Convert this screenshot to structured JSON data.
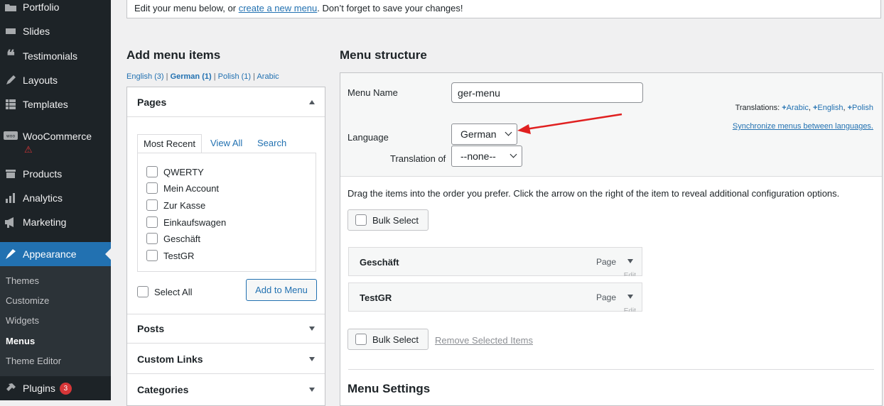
{
  "sidebar": {
    "items": [
      {
        "label": "Portfolio",
        "icon": "portfolio-icon"
      },
      {
        "label": "Slides",
        "icon": "slides-icon"
      },
      {
        "label": "Testimonials",
        "icon": "quote-icon"
      },
      {
        "label": "Layouts",
        "icon": "layouts-icon"
      },
      {
        "label": "Templates",
        "icon": "templates-icon"
      },
      {
        "label": "WooCommerce",
        "icon": "woocommerce-icon"
      },
      {
        "label": "Products",
        "icon": "products-icon"
      },
      {
        "label": "Analytics",
        "icon": "analytics-icon"
      },
      {
        "label": "Marketing",
        "icon": "marketing-icon"
      },
      {
        "label": "Appearance",
        "icon": "appearance-icon"
      },
      {
        "label": "Plugins",
        "icon": "plugins-icon",
        "badge": "3"
      }
    ],
    "submenu": [
      "Themes",
      "Customize",
      "Widgets",
      "Menus",
      "Theme Editor"
    ],
    "woo_warning": "⚠"
  },
  "notice": {
    "before": "Edit your menu below, or ",
    "link": "create a new menu",
    "after": ". Don’t forget to save your changes!"
  },
  "add_items": {
    "title": "Add menu items",
    "langs": {
      "english": "English (3)",
      "german": "German (1)",
      "polish": "Polish (1)",
      "arabic": "Arabic",
      "sep": "|"
    },
    "pages_title": "Pages",
    "tabs": [
      "Most Recent",
      "View All",
      "Search"
    ],
    "pages": [
      "QWERTY",
      "Mein Account",
      "Zur Kasse",
      "Einkaufswagen",
      "Geschäft",
      "TestGR"
    ],
    "select_all": "Select All",
    "add_button": "Add to Menu",
    "sections": [
      "Posts",
      "Custom Links",
      "Categories"
    ]
  },
  "structure": {
    "title": "Menu structure",
    "menu_name_label": "Menu Name",
    "menu_name_value": "ger-menu",
    "language_label": "Language",
    "language_value": "German",
    "translation_label": "Translation of",
    "translation_value": "--none--",
    "translations_label": "Translations:",
    "translations": [
      "Arabic",
      "English",
      "Polish"
    ],
    "sync_link": "Synchronize menus between languages.",
    "instructions": "Drag the items into the order you prefer. Click the arrow on the right of the item to reveal additional configuration options.",
    "bulk_select": "Bulk Select",
    "items": [
      {
        "name": "Geschäft",
        "type": "Page"
      },
      {
        "name": "TestGR",
        "type": "Page"
      }
    ],
    "edit_label": "Edit",
    "remove_selected": "Remove Selected Items",
    "settings_title": "Menu Settings"
  },
  "annotation": {
    "color": "#e02020"
  }
}
